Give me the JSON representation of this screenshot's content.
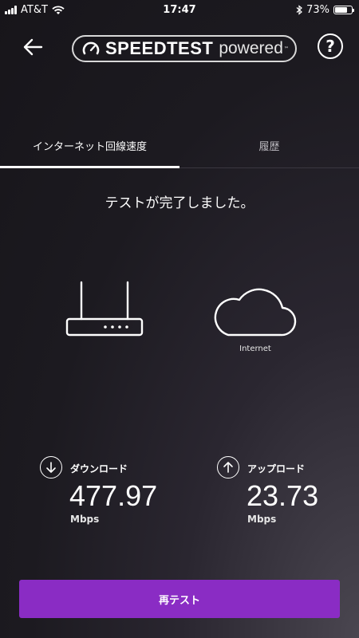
{
  "status_bar": {
    "carrier": "AT&T",
    "time": "17:47",
    "battery_percent": "73%",
    "battery_level": 0.73,
    "icons": [
      "signal-icon",
      "wifi-icon",
      "bluetooth-icon",
      "battery-icon"
    ]
  },
  "header": {
    "brand_name": "SPEEDTEST",
    "brand_powered": "powered",
    "brand_tm": "™",
    "help_symbol": "?",
    "icons": [
      "back-arrow-icon",
      "speedtest-gauge-icon",
      "help-icon"
    ]
  },
  "tabs": [
    {
      "label": "インターネット回線速度",
      "active": true
    },
    {
      "label": "履歴",
      "active": false
    }
  ],
  "main": {
    "status_message": "テストが完了しました。",
    "internet_label": "Internet",
    "icons": [
      "router-icon",
      "cloud-icon"
    ]
  },
  "results": {
    "download": {
      "label": "ダウンロード",
      "value": "477.97",
      "unit": "Mbps",
      "icon": "download-arrow-icon"
    },
    "upload": {
      "label": "アップロード",
      "value": "23.73",
      "unit": "Mbps",
      "icon": "upload-arrow-icon"
    }
  },
  "retest_button": {
    "label": "再テスト"
  },
  "colors": {
    "accent": "#8a2cc4",
    "background": "#1c1a20",
    "text": "#ffffff"
  }
}
